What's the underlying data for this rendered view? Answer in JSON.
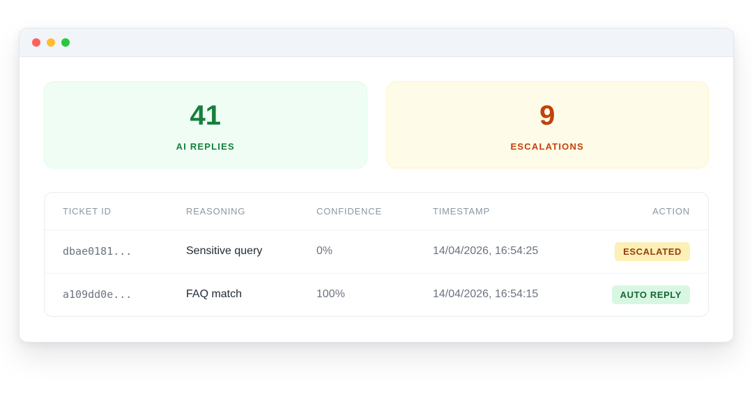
{
  "window": {
    "controls": [
      {
        "name": "close",
        "color": "#ff605c"
      },
      {
        "name": "minimize",
        "color": "#ffbd2e"
      },
      {
        "name": "maximize",
        "color": "#27c93f"
      }
    ]
  },
  "stats": {
    "ai_replies": {
      "value": "41",
      "label": "AI REPLIES",
      "color": "#15803d"
    },
    "escalations": {
      "value": "9",
      "label": "ESCALATIONS",
      "color": "#c2410c"
    }
  },
  "table": {
    "headers": [
      "TICKET ID",
      "REASONING",
      "CONFIDENCE",
      "TIMESTAMP",
      "ACTION"
    ],
    "rows": [
      {
        "ticket_id": "dbae0181...",
        "reasoning": "Sensitive query",
        "confidence": "0%",
        "timestamp": "14/04/2026, 16:54:25",
        "action": "ESCALATED"
      },
      {
        "ticket_id": "a109dd0e...",
        "reasoning": "FAQ match",
        "confidence": "100%",
        "timestamp": "14/04/2026, 16:54:15",
        "action": "AUTO REPLY"
      }
    ]
  }
}
